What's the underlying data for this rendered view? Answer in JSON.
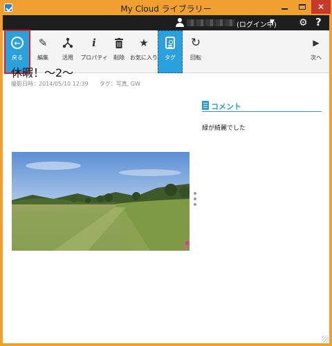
{
  "window": {
    "title": "My Cloud ライブラリー",
    "minimize": "—",
    "maximize": "□",
    "close": "✕"
  },
  "topbar": {
    "login_status": "(ログイン中)",
    "caret": "▼",
    "gear": "⚙",
    "help": "?"
  },
  "toolbar": {
    "items": [
      {
        "label": "戻る",
        "icon": "back-arrow-icon"
      },
      {
        "label": "編集",
        "icon": "pencil-icon",
        "glyph": "✎"
      },
      {
        "label": "活用",
        "icon": "share-icon",
        "glyph": "⅄"
      },
      {
        "label": "プロパティ",
        "icon": "info-icon",
        "glyph": "i"
      },
      {
        "label": "削除",
        "icon": "trash-icon",
        "glyph": "🗑"
      },
      {
        "label": "お気に入り",
        "icon": "star-icon",
        "glyph": "★"
      },
      {
        "label": "タグ",
        "icon": "tag-icon"
      },
      {
        "label": "回転",
        "icon": "rotate-icon",
        "glyph": "↻"
      },
      {
        "label": "次へ",
        "icon": "play-next-icon",
        "glyph": "▶"
      }
    ]
  },
  "photo": {
    "title": "休暇！～2～",
    "meta": "撮影日時：2014/05/10 12:39　　タグ：写真, GW"
  },
  "comment": {
    "heading": "コメント",
    "text": "緑が綺麗でした"
  },
  "colors": {
    "accent": "#2aa0dc",
    "frame": "#f0a030",
    "highlight": "#e0201c"
  }
}
